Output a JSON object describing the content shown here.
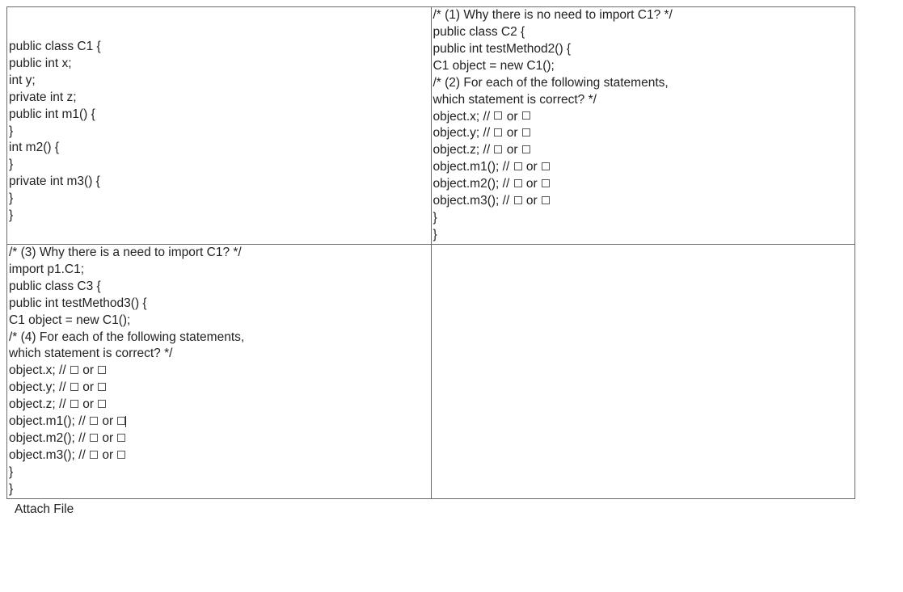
{
  "cells": {
    "c1": {
      "spacer": " ",
      "l1": "public class C1 {",
      "l2": "public int x;",
      "l3": "int y;",
      "l4": "private int z;",
      "l5": "public int m1() {",
      "l6": "}",
      "l7": "int m2() {",
      "l8": "}",
      "l9": "private int m3() {",
      "l10": "}",
      "l11": "}"
    },
    "c2": {
      "l1": "/* (1) Why there is no need to import C1? */",
      "l2": "public class C2 {",
      "l3": "public int testMethod2() {",
      "l4": "C1 object = new C1();",
      "l5": "/* (2) For each of the following statements,",
      "l6": "which statement is correct? */",
      "s1a": "object.x; // ",
      "or": " or ",
      "s2a": "object.y; // ",
      "s3a": "object.z; // ",
      "s4a": "object.m1(); // ",
      "s5a": "object.m2(); // ",
      "s6a": "object.m3(); // ",
      "l13": "}",
      "l14": "}"
    },
    "c3": {
      "l1": "/* (3) Why there is a need to import C1? */",
      "l2": "import p1.C1;",
      "l3": "public class C3 {",
      "l4": "public int testMethod3() {",
      "l5": "C1 object = new C1();",
      "l6": "/* (4) For each of the following statements,",
      "l7": "which statement is correct? */",
      "s1a": "object.x; // ",
      "or": " or ",
      "s2a": "object.y; // ",
      "s3a": "object.z; // ",
      "s4a": "object.m1(); // ",
      "s5a": "object.m2(); // ",
      "s6a": "object.m3(); // ",
      "l14": "}",
      "l15": "}"
    }
  },
  "attach_label": "Attach File"
}
